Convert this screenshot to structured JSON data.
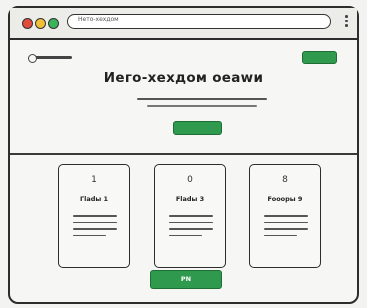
{
  "browser": {
    "url_text": "Нето-хехдом",
    "controls": [
      "close",
      "minimize",
      "maximize"
    ],
    "menu_icon": "kebab-menu-icon"
  },
  "header": {
    "logo": "logo-mark",
    "nav_button_label": ""
  },
  "hero": {
    "title": "Иего-хехдом оеаwи",
    "cta_label": ""
  },
  "cards": [
    {
      "number": "1",
      "title": "Гladы 1"
    },
    {
      "number": "0",
      "title": "Fladы 3"
    },
    {
      "number": "8",
      "title": "Fooopы 9"
    }
  ],
  "footer": {
    "button_label": "PN"
  },
  "colors": {
    "accent": "#2f9a4e",
    "accent_border": "#1f6e36",
    "outline": "#2d2d2d",
    "background": "#f6f6f4"
  }
}
